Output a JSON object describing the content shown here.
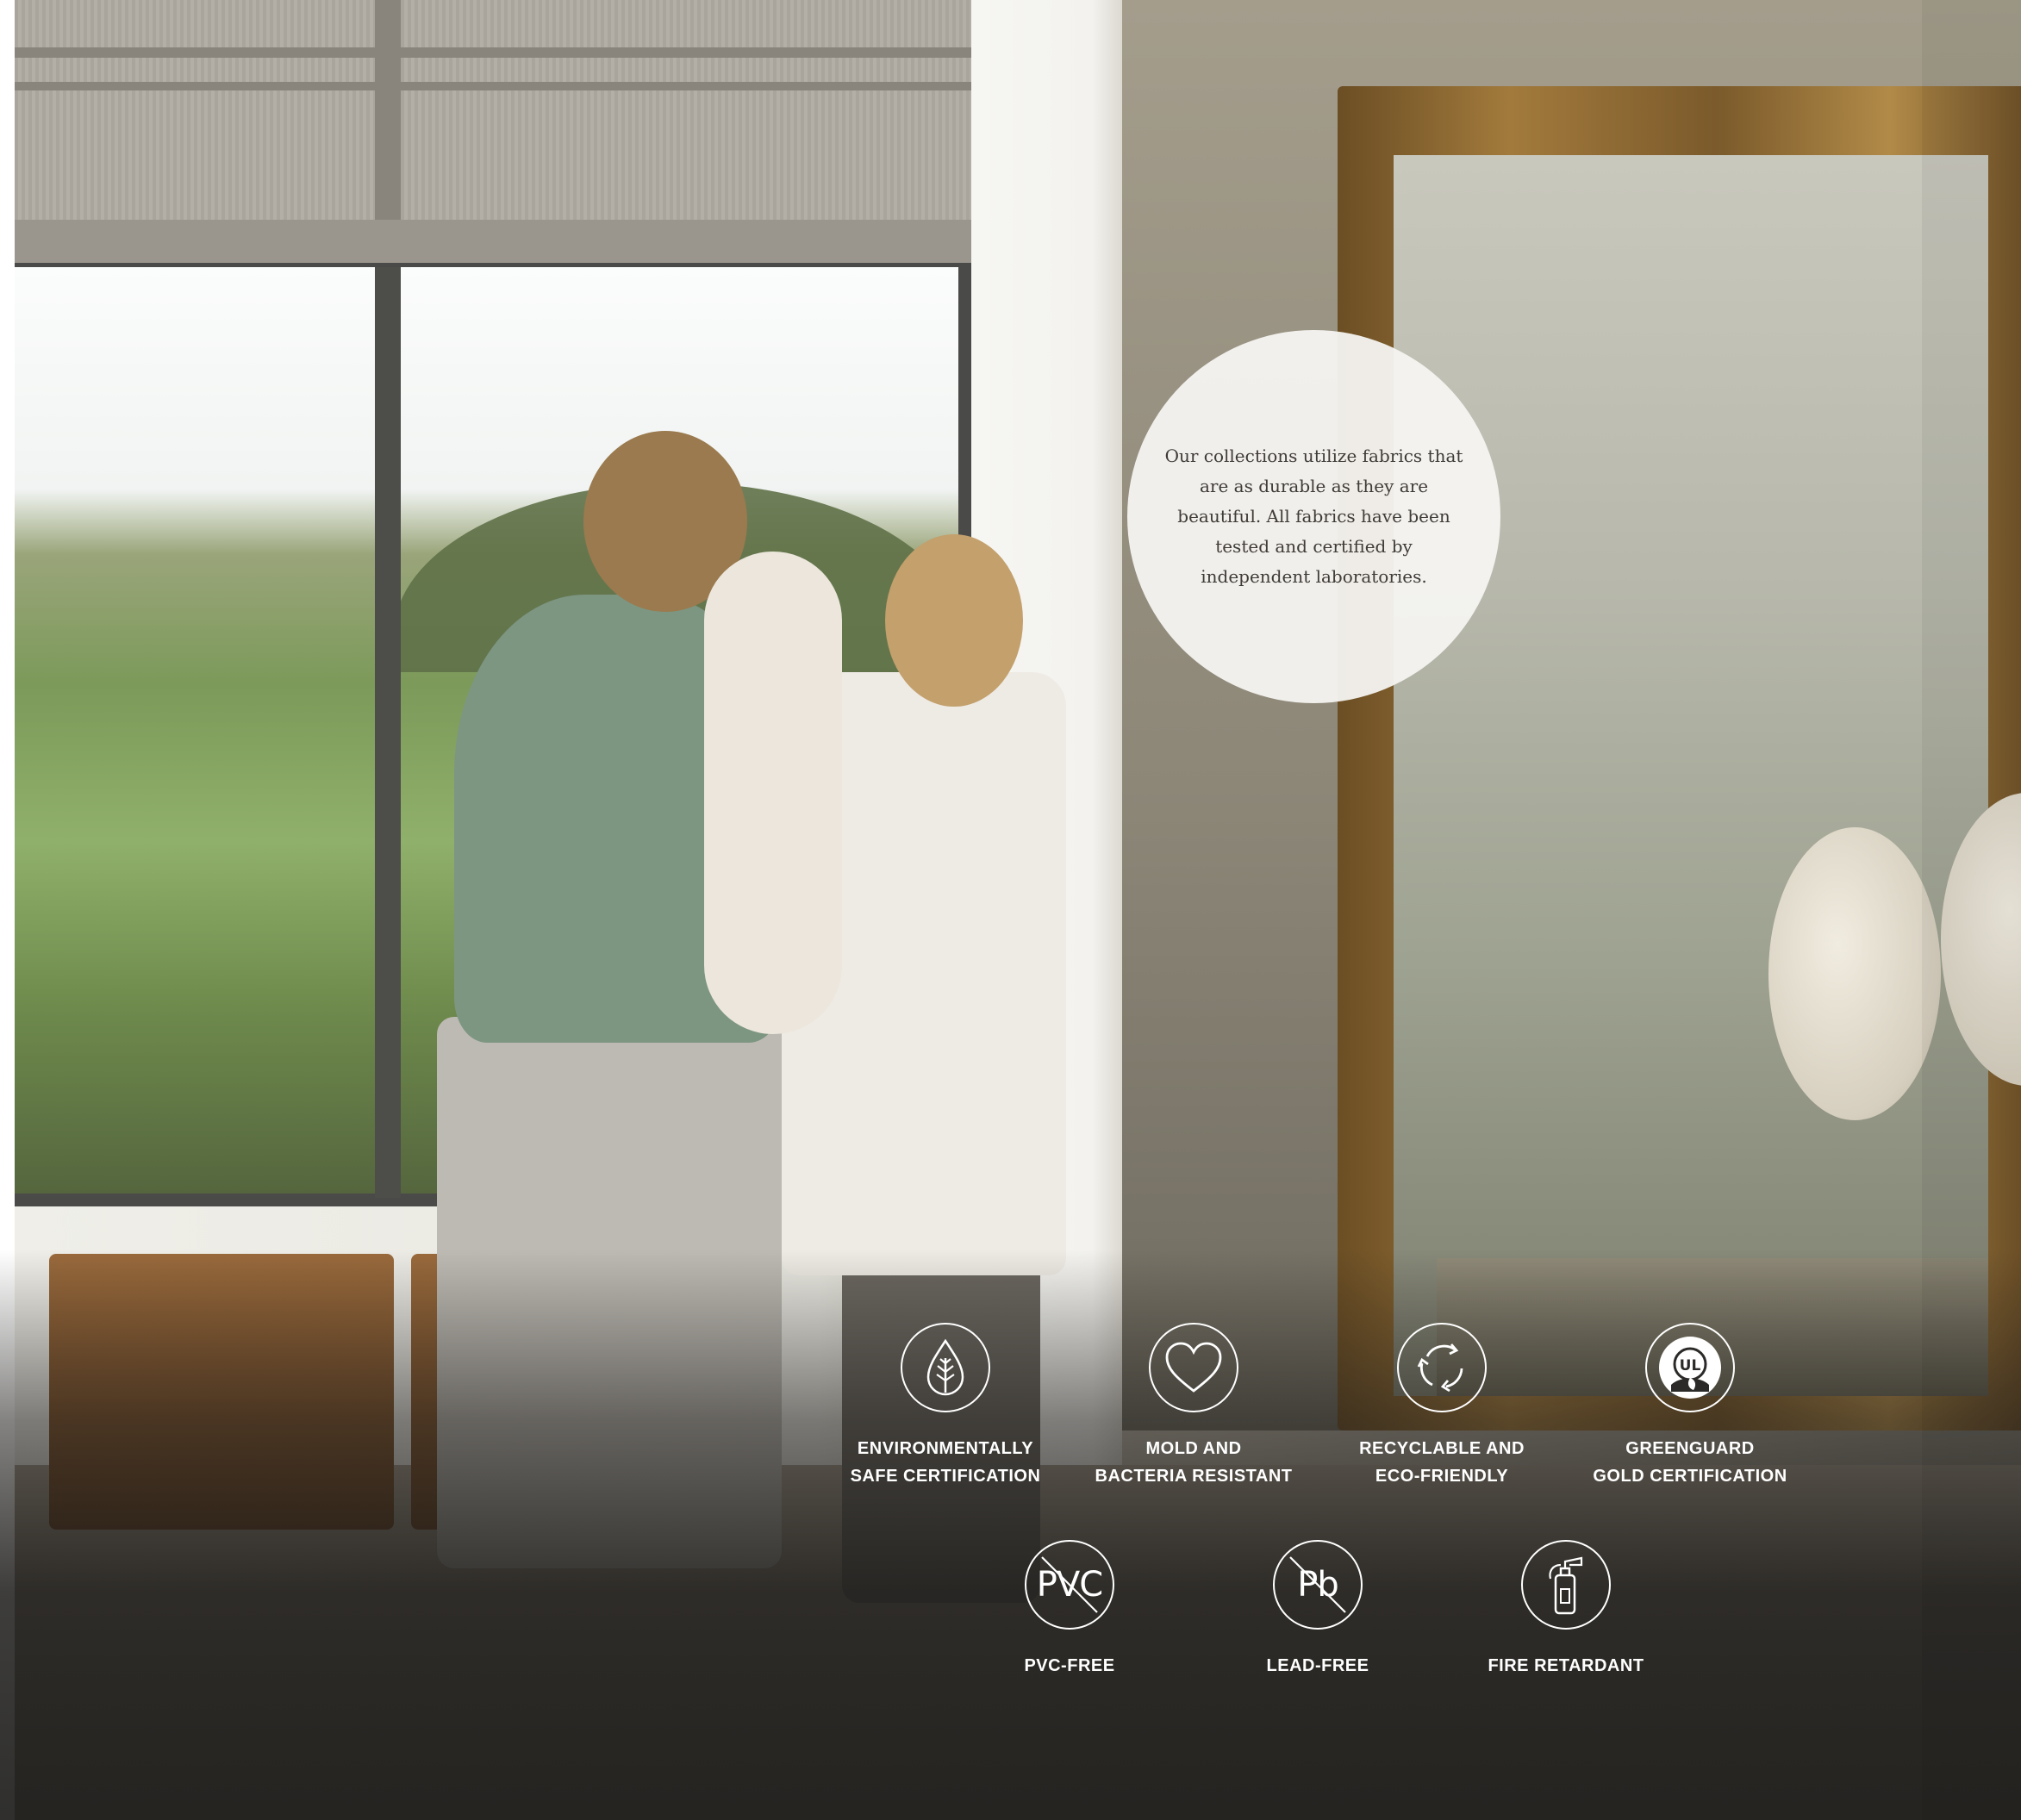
{
  "info": {
    "text": "Our collections utilize fabrics that are as durable as they are beautiful. All fabrics have been tested and certified by independent laboratories."
  },
  "features": [
    {
      "icon": "leaf-drop-icon",
      "line1": "ENVIRONMENTALLY",
      "line2": "SAFE CERTIFICATION"
    },
    {
      "icon": "heart-icon",
      "line1": "MOLD AND",
      "line2": "BACTERIA RESISTANT"
    },
    {
      "icon": "recycle-icon",
      "line1": "RECYCLABLE AND",
      "line2": "ECO-FRIENDLY"
    },
    {
      "icon": "ul-greenguard-icon",
      "line1": "GREENGUARD",
      "line2": "GOLD CERTIFICATION"
    },
    {
      "icon": "pvc-free-icon",
      "badge_text": "PVC",
      "line1": "PVC-FREE"
    },
    {
      "icon": "lead-free-icon",
      "badge_text": "Pb",
      "line1": "LEAD-FREE"
    },
    {
      "icon": "fire-extinguisher-icon",
      "line1": "FIRE RETARDANT"
    }
  ],
  "greenguard_badge_text": "UL",
  "colors": {
    "text_light": "#ffffff",
    "circle_bg": "#f6f4f1",
    "circle_text": "#3f3b37"
  }
}
